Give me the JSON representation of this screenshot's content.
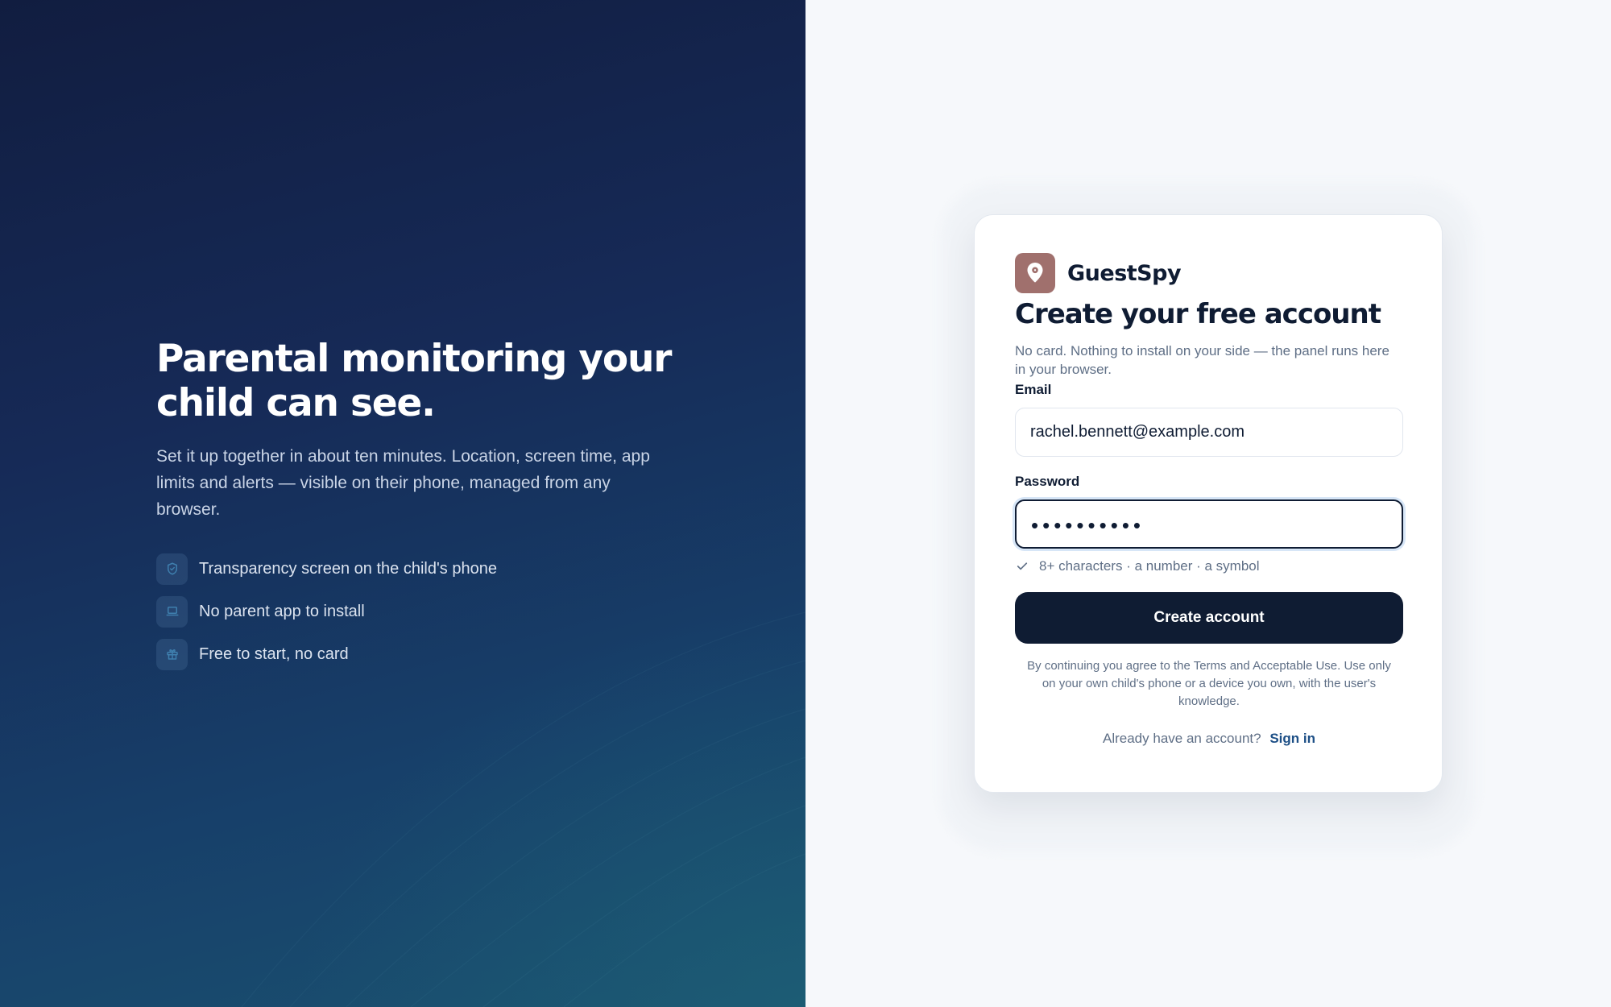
{
  "hero": {
    "title": "Parental monitoring your child can see.",
    "subtitle": "Set it up together in about ten minutes. Location, screen time, app limits and alerts — visible on their phone, managed from any browser.",
    "features": [
      {
        "icon": "shield-icon",
        "label": "Transparency screen on the child's phone"
      },
      {
        "icon": "laptop-icon",
        "label": "No parent app to install"
      },
      {
        "icon": "gift-icon",
        "label": "Free to start, no card"
      }
    ]
  },
  "card": {
    "brand": {
      "name": "GuestSpy",
      "logo_icon": "location-pin-icon",
      "logo_color": "#a0706d"
    },
    "title": "Create your free account",
    "subtitle": "No card. Nothing to install on your side — the panel runs here in your browser.",
    "email": {
      "label": "Email",
      "value": "rachel.bennett@example.com"
    },
    "password": {
      "label": "Password",
      "masked_value": "••••••••••",
      "hint": "8+ characters · a number · a symbol"
    },
    "submit_label": "Create account",
    "legal": "By continuing you agree to the Terms and Acceptable Use. Use only on your own child's phone or a device you own, with the user's knowledge.",
    "signin_prompt": "Already have an account?",
    "signin_link": "Sign in"
  },
  "colors": {
    "primary": "#0f1c33",
    "accent_link": "#1d4f86",
    "brand_logo": "#a0706d",
    "hero_dark": "#111d40",
    "hero_teal": "#1a5270"
  }
}
